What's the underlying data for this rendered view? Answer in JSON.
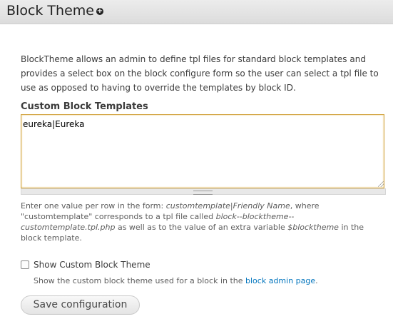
{
  "page": {
    "title": "Block Theme",
    "add_icon": "plus-circle-icon"
  },
  "description": "BlockTheme allows an admin to define tpl files for standard block templates and provides a select box on the block configure form so the user can select a tpl file to use as opposed to having to override the templates by block ID.",
  "custom_templates": {
    "label": "Custom Block Templates",
    "value": "eureka|Eureka",
    "help": {
      "part1": "Enter one value per row in the form: ",
      "em1": "customtemplate|Friendly Name",
      "part2": ", where \"customtemplate\" corresponds to a tpl file called ",
      "em2": "block--blocktheme--customtemplate.tpl.php",
      "part3": " as well as to the value of an extra variable ",
      "em3": "$blocktheme",
      "part4": " in the block template."
    }
  },
  "show_custom": {
    "label": "Show Custom Block Theme",
    "checked": false,
    "desc_prefix": "Show the custom block theme used for a block in the ",
    "link_text": "block admin page",
    "desc_suffix": "."
  },
  "actions": {
    "save_label": "Save configuration"
  }
}
